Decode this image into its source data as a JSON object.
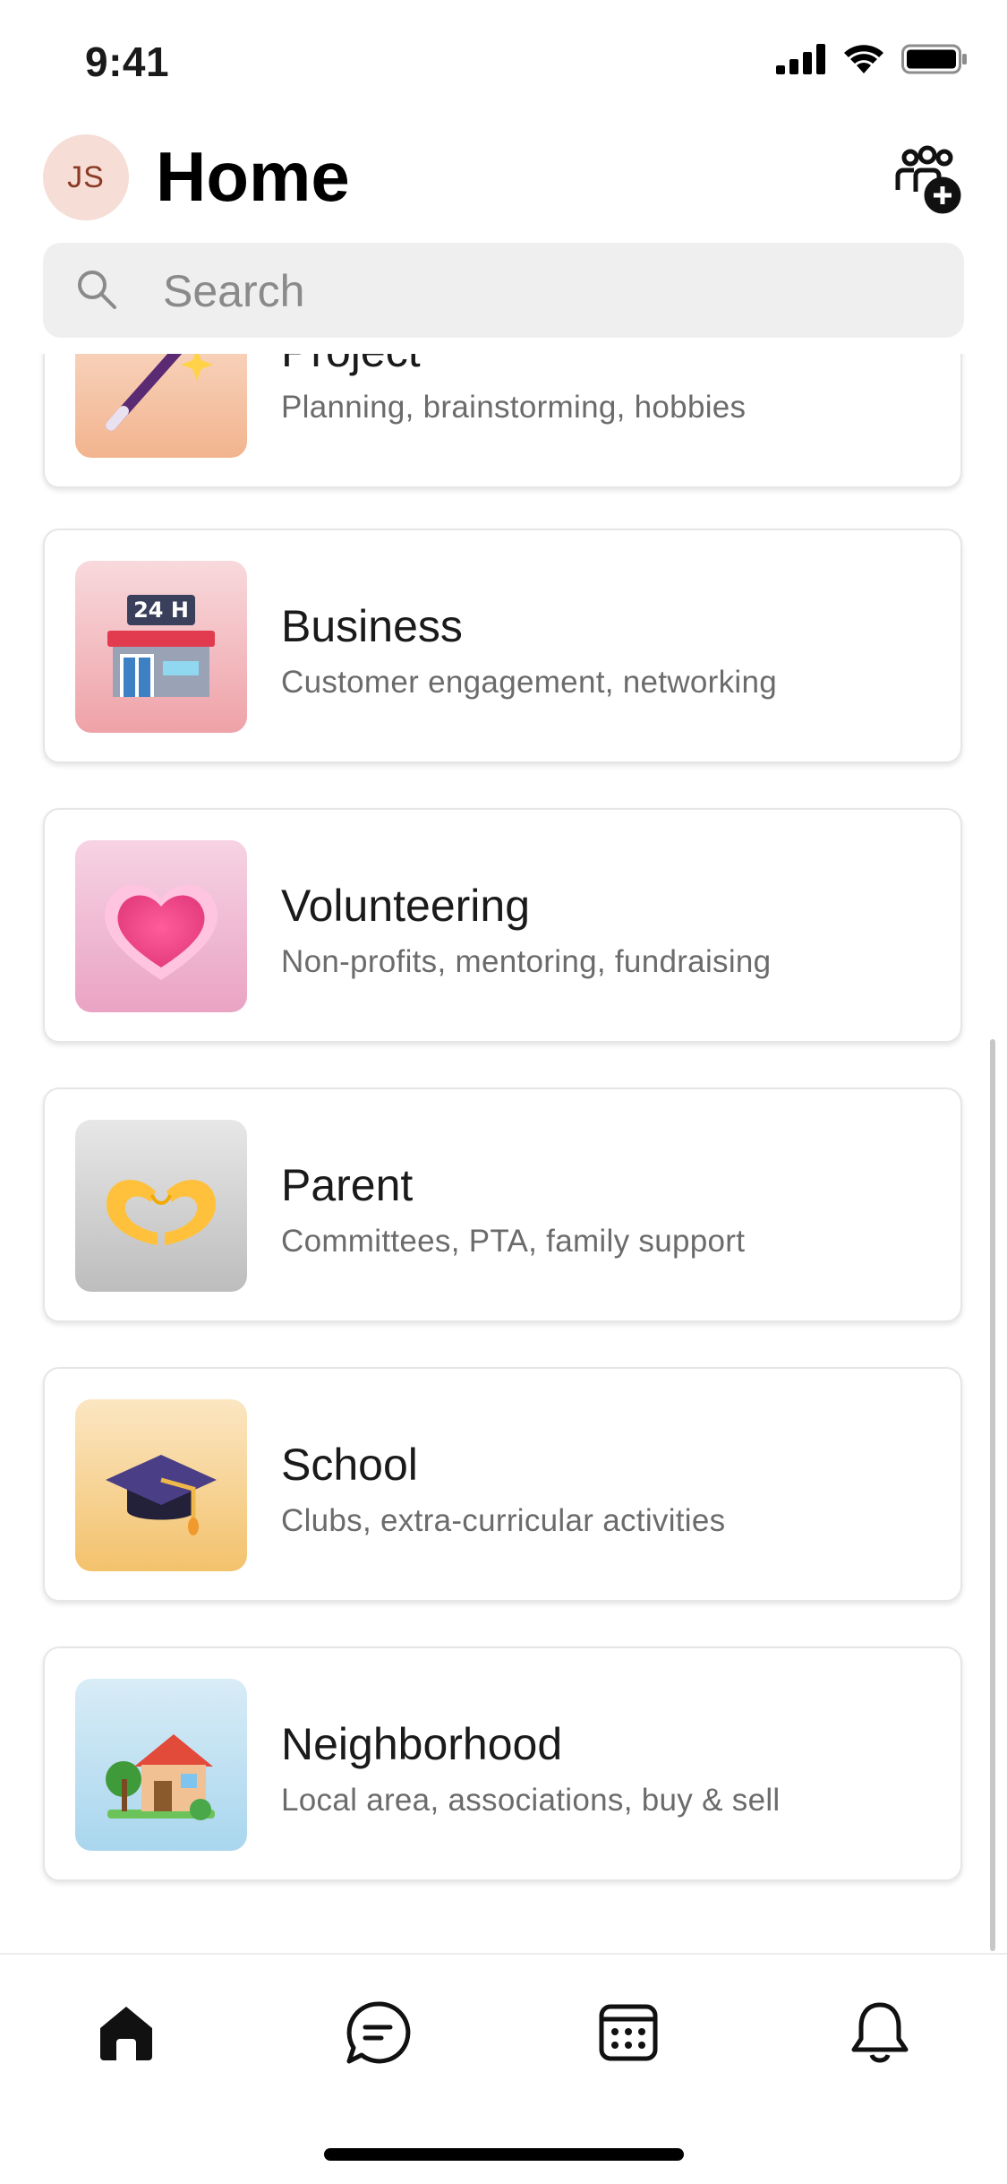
{
  "status_bar": {
    "time": "9:41"
  },
  "header": {
    "avatar_initials": "JS",
    "title": "Home"
  },
  "search": {
    "placeholder": "Search",
    "value": ""
  },
  "categories": [
    {
      "title": "Project",
      "subtitle": "Planning, brainstorming, hobbies",
      "icon": "magic-wand-icon"
    },
    {
      "title": "Business",
      "subtitle": "Customer engagement, networking",
      "icon": "store-24h-icon",
      "sign": "24 H"
    },
    {
      "title": "Volunteering",
      "subtitle": "Non-profits, mentoring, fundraising",
      "icon": "heart-icon"
    },
    {
      "title": "Parent",
      "subtitle": "Committees, PTA, family support",
      "icon": "heart-hands-icon"
    },
    {
      "title": "School",
      "subtitle": "Clubs, extra-curricular activities",
      "icon": "graduation-cap-icon"
    },
    {
      "title": "Neighborhood",
      "subtitle": "Local area, associations, buy & sell",
      "icon": "house-icon"
    }
  ],
  "tabs": [
    {
      "name": "home",
      "icon": "home-icon",
      "selected": true
    },
    {
      "name": "chat",
      "icon": "chat-icon",
      "selected": false
    },
    {
      "name": "calendar",
      "icon": "calendar-icon",
      "selected": false
    },
    {
      "name": "notifications",
      "icon": "bell-icon",
      "selected": false
    }
  ]
}
